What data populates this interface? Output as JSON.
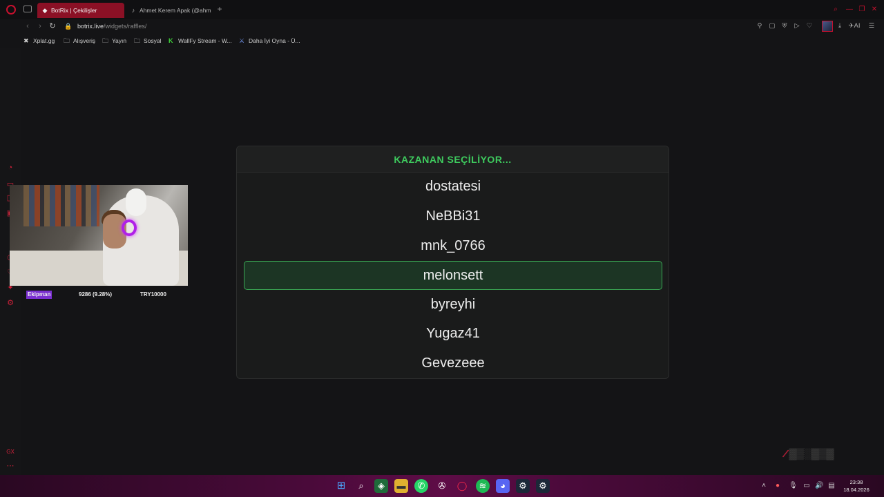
{
  "tabs": [
    {
      "label": "BotRix | Çekilişler",
      "favicon": "botrix-icon"
    },
    {
      "label": "Ahmet Kerem Apak (@ahm",
      "favicon": "tiktok-icon"
    }
  ],
  "address": {
    "domain": "botrix.live",
    "path": "/widgets/raffles/"
  },
  "bookmarks": [
    {
      "label": "Xplat.gg",
      "icon": "x-icon"
    },
    {
      "label": "Alışveriş",
      "icon": "folder-icon"
    },
    {
      "label": "Yayın",
      "icon": "folder-icon"
    },
    {
      "label": "Sosyal",
      "icon": "folder-icon"
    },
    {
      "label": "WallFy Stream - W...",
      "icon": "k-icon"
    },
    {
      "label": "Daha İyi Oyna - Ü...",
      "icon": "sword-icon"
    }
  ],
  "webcam_bar": {
    "tag": "Ekipman",
    "middle": "9286 (9.28%)",
    "right": "TRY10000"
  },
  "raffle": {
    "header": "KAZANAN SEÇİLİYOR...",
    "entries": [
      "dostatesi",
      "NeBBi31",
      "mnk_0766",
      "melonsett",
      "byreyhi",
      "Yugaz41",
      "Gevezeee"
    ],
    "selected_index": 3
  },
  "clock": {
    "time": "23:38",
    "date": "18.04.2026"
  },
  "colors": {
    "accent_red": "#c8102e",
    "raffle_green": "#3ecb5e",
    "selected_bg": "#1c3524"
  }
}
